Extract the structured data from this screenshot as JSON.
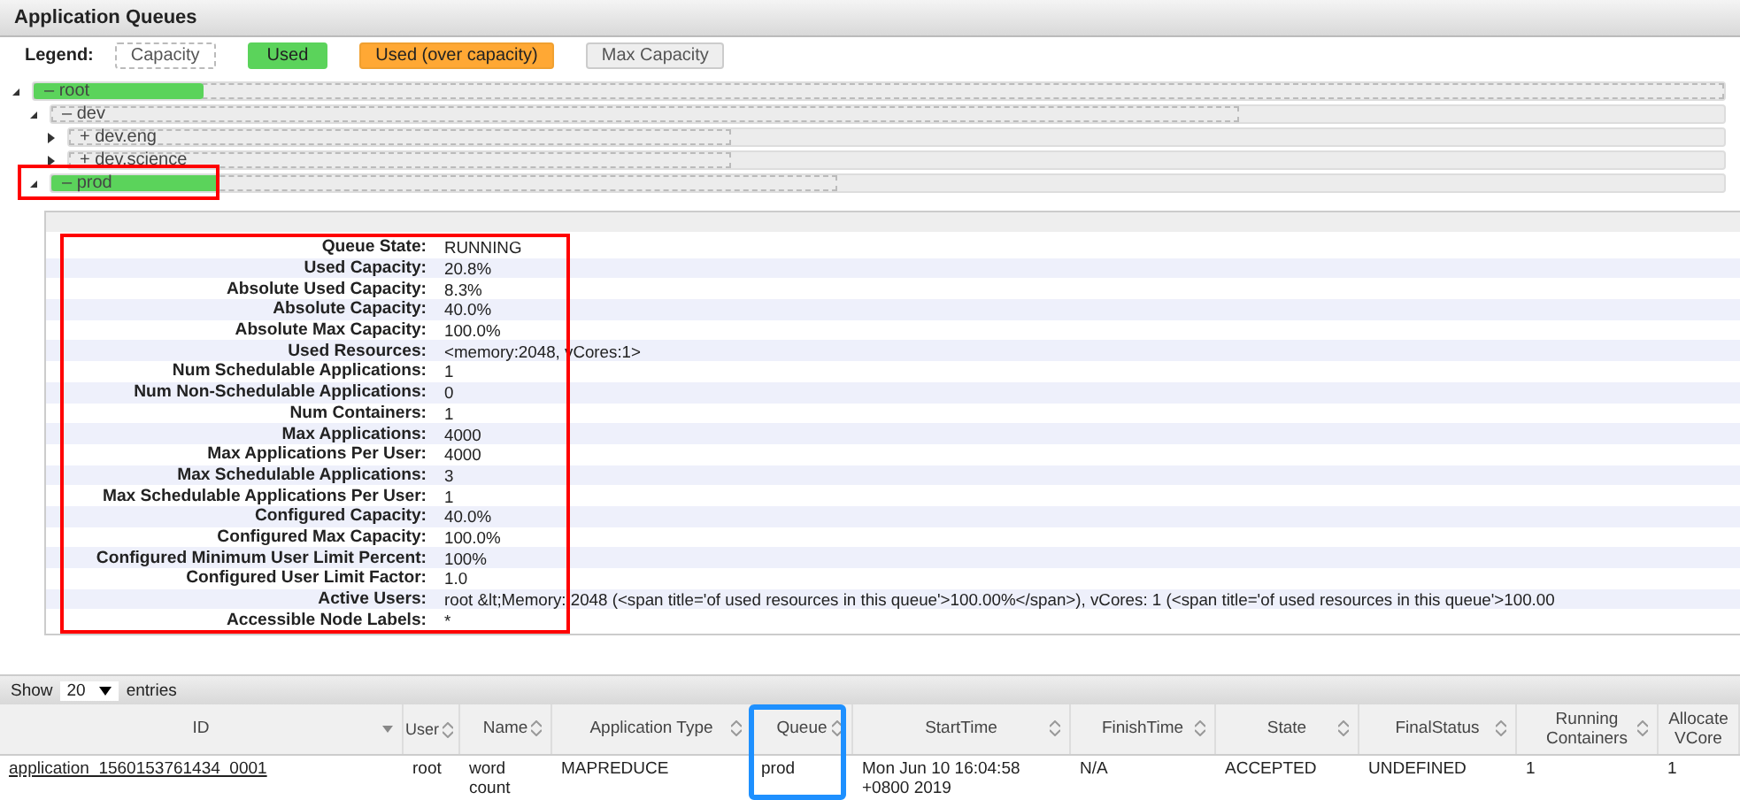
{
  "panel": {
    "title": "Application Queues"
  },
  "legend": {
    "label": "Legend:",
    "items": [
      {
        "kind": "capacity",
        "label": "Capacity"
      },
      {
        "kind": "used",
        "label": "Used"
      },
      {
        "kind": "over",
        "label": "Used (over capacity)"
      },
      {
        "kind": "max",
        "label": "Max Capacity"
      }
    ]
  },
  "queues": [
    {
      "name": "root",
      "sign": "–",
      "expanded": true,
      "capacity": {
        "level": 1
      },
      "used": {
        "level": 0.1
      },
      "children": [
        {
          "name": "dev",
          "sign": "–",
          "expanded": true,
          "capacity": {
            "level": 0.71
          },
          "children": [
            {
              "name": "dev.eng",
              "sign": "+",
              "expanded": false,
              "capacity": {
                "level": 0.4
              }
            },
            {
              "name": "dev.science",
              "sign": "+",
              "expanded": false,
              "capacity": {
                "level": 0.4
              }
            }
          ]
        },
        {
          "name": "prod",
          "sign": "–",
          "expanded": true,
          "highlighted": true,
          "capacity": {
            "level": 0.47
          },
          "used": {
            "level": 0.1
          }
        }
      ]
    }
  ],
  "details": {
    "highlighted": true,
    "rows": [
      {
        "label": "Queue State:",
        "value": "RUNNING"
      },
      {
        "label": "Used Capacity:",
        "value": "20.8%"
      },
      {
        "label": "Absolute Used Capacity:",
        "value": "8.3%"
      },
      {
        "label": "Absolute Capacity:",
        "value": "40.0%"
      },
      {
        "label": "Absolute Max Capacity:",
        "value": "100.0%"
      },
      {
        "label": "Used Resources:",
        "value": "<memory:2048, vCores:1>"
      },
      {
        "label": "Num Schedulable Applications:",
        "value": "1"
      },
      {
        "label": "Num Non-Schedulable Applications:",
        "value": "0"
      },
      {
        "label": "Num Containers:",
        "value": "1"
      },
      {
        "label": "Max Applications:",
        "value": "4000"
      },
      {
        "label": "Max Applications Per User:",
        "value": "4000"
      },
      {
        "label": "Max Schedulable Applications:",
        "value": "3"
      },
      {
        "label": "Max Schedulable Applications Per User:",
        "value": "1"
      },
      {
        "label": "Configured Capacity:",
        "value": "40.0%"
      },
      {
        "label": "Configured Max Capacity:",
        "value": "100.0%"
      },
      {
        "label": "Configured Minimum User Limit Percent:",
        "value": "100%"
      },
      {
        "label": "Configured User Limit Factor:",
        "value": "1.0"
      },
      {
        "label": "Active Users:",
        "value": "root &lt;Memory: 2048 (<span title='of used resources in this queue'>100.00%</span>), vCores: 1 (<span title='of used resources in this queue'>100.00"
      },
      {
        "label": "Accessible Node Labels:",
        "value": "*"
      }
    ]
  },
  "table": {
    "show_label": "Show",
    "page_size": "20",
    "entries_label": "entries",
    "columns": [
      {
        "label": "ID",
        "sorted": true,
        "highlighted": false
      },
      {
        "label": "User",
        "sorted": false,
        "highlighted": false
      },
      {
        "label": "Name",
        "sorted": false,
        "highlighted": false
      },
      {
        "label": "Application Type",
        "sorted": false,
        "highlighted": false
      },
      {
        "label": "Queue",
        "sorted": false,
        "highlighted": true
      },
      {
        "label": "StartTime",
        "sorted": false,
        "highlighted": false
      },
      {
        "label": "FinishTime",
        "sorted": false,
        "highlighted": false
      },
      {
        "label": "State",
        "sorted": false,
        "highlighted": false
      },
      {
        "label": "FinalStatus",
        "sorted": false,
        "highlighted": false
      },
      {
        "label": "Running Containers",
        "sorted": false,
        "highlighted": false
      },
      {
        "label": "Allocate VCore",
        "sorted": false,
        "highlighted": false
      }
    ],
    "rows": [
      [
        "application_1560153761434_0001",
        "root",
        "word count",
        "MAPREDUCE",
        "prod",
        "Mon Jun 10 16:04:58 +0800 2019",
        "N/A",
        "ACCEPTED",
        "UNDEFINED",
        "1",
        "1"
      ]
    ]
  }
}
